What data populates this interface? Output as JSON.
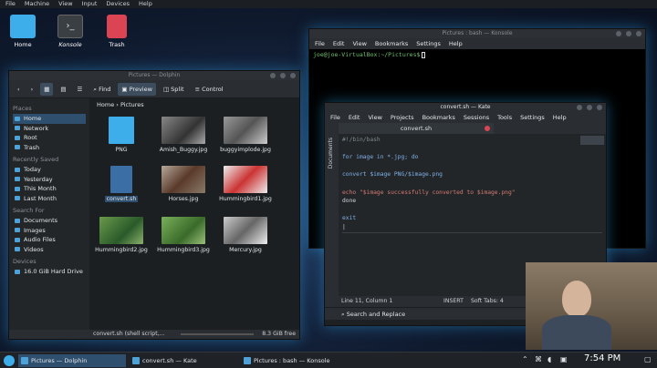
{
  "vm_menu": [
    "File",
    "Machine",
    "View",
    "Input",
    "Devices",
    "Help"
  ],
  "desktop_icons": [
    "Home",
    "Konsole",
    "Trash"
  ],
  "dolphin": {
    "title": "Pictures — Dolphin",
    "toolbar": {
      "find": "Find",
      "preview": "Preview",
      "split": "Split",
      "control": "Control"
    },
    "breadcrumb": [
      "Home",
      "Pictures"
    ],
    "places_header": "Places",
    "places": [
      "Home",
      "Network",
      "Root",
      "Trash"
    ],
    "recent_header": "Recently Saved",
    "recent": [
      "Today",
      "Yesterday",
      "This Month",
      "Last Month"
    ],
    "search_header": "Search For",
    "search": [
      "Documents",
      "Images",
      "Audio Files",
      "Videos"
    ],
    "devices_header": "Devices",
    "devices": [
      "16.0 GiB Hard Drive"
    ],
    "files": [
      {
        "name": "PNG",
        "kind": "folder"
      },
      {
        "name": "Amish_Buggy.jpg",
        "kind": "image"
      },
      {
        "name": "buggyimplode.jpg",
        "kind": "image"
      },
      {
        "name": "convert.sh",
        "kind": "script"
      },
      {
        "name": "Horses.jpg",
        "kind": "image"
      },
      {
        "name": "Hummingbird1.jpg",
        "kind": "image"
      },
      {
        "name": "Hummingbird2.jpg",
        "kind": "image"
      },
      {
        "name": "Hummingbird3.jpg",
        "kind": "image"
      },
      {
        "name": "Mercury.jpg",
        "kind": "image"
      }
    ],
    "status": "convert.sh (shell script,...",
    "free": "8.3 GiB free"
  },
  "konsole": {
    "title": "Pictures : bash — Konsole",
    "menu": [
      "File",
      "Edit",
      "View",
      "Bookmarks",
      "Settings",
      "Help"
    ],
    "prompt": "joe@joe-VirtualBox:~/Pictures$"
  },
  "kate": {
    "title": "convert.sh — Kate",
    "menu": [
      "File",
      "Edit",
      "View",
      "Projects",
      "Bookmarks",
      "Sessions",
      "Tools",
      "Settings",
      "Help"
    ],
    "tab": "convert.sh",
    "side_label": "Documents",
    "status": {
      "position": "Line 11, Column 1",
      "mode": "INSERT",
      "tabs": "Soft Tabs: 4"
    },
    "search_label": "Search and Replace",
    "code_lines": [
      "#!/bin/bash",
      "",
      "for image in *.jpg; do",
      "",
      "convert $image PNG/$image.png",
      "",
      "echo \"$image successfully converted to $image.png\"",
      "done",
      "",
      "exit",
      ""
    ]
  },
  "taskbar": {
    "items": [
      "Pictures — Dolphin",
      "convert.sh — Kate",
      "Pictures : bash — Konsole"
    ],
    "clock": "7:54 PM"
  }
}
